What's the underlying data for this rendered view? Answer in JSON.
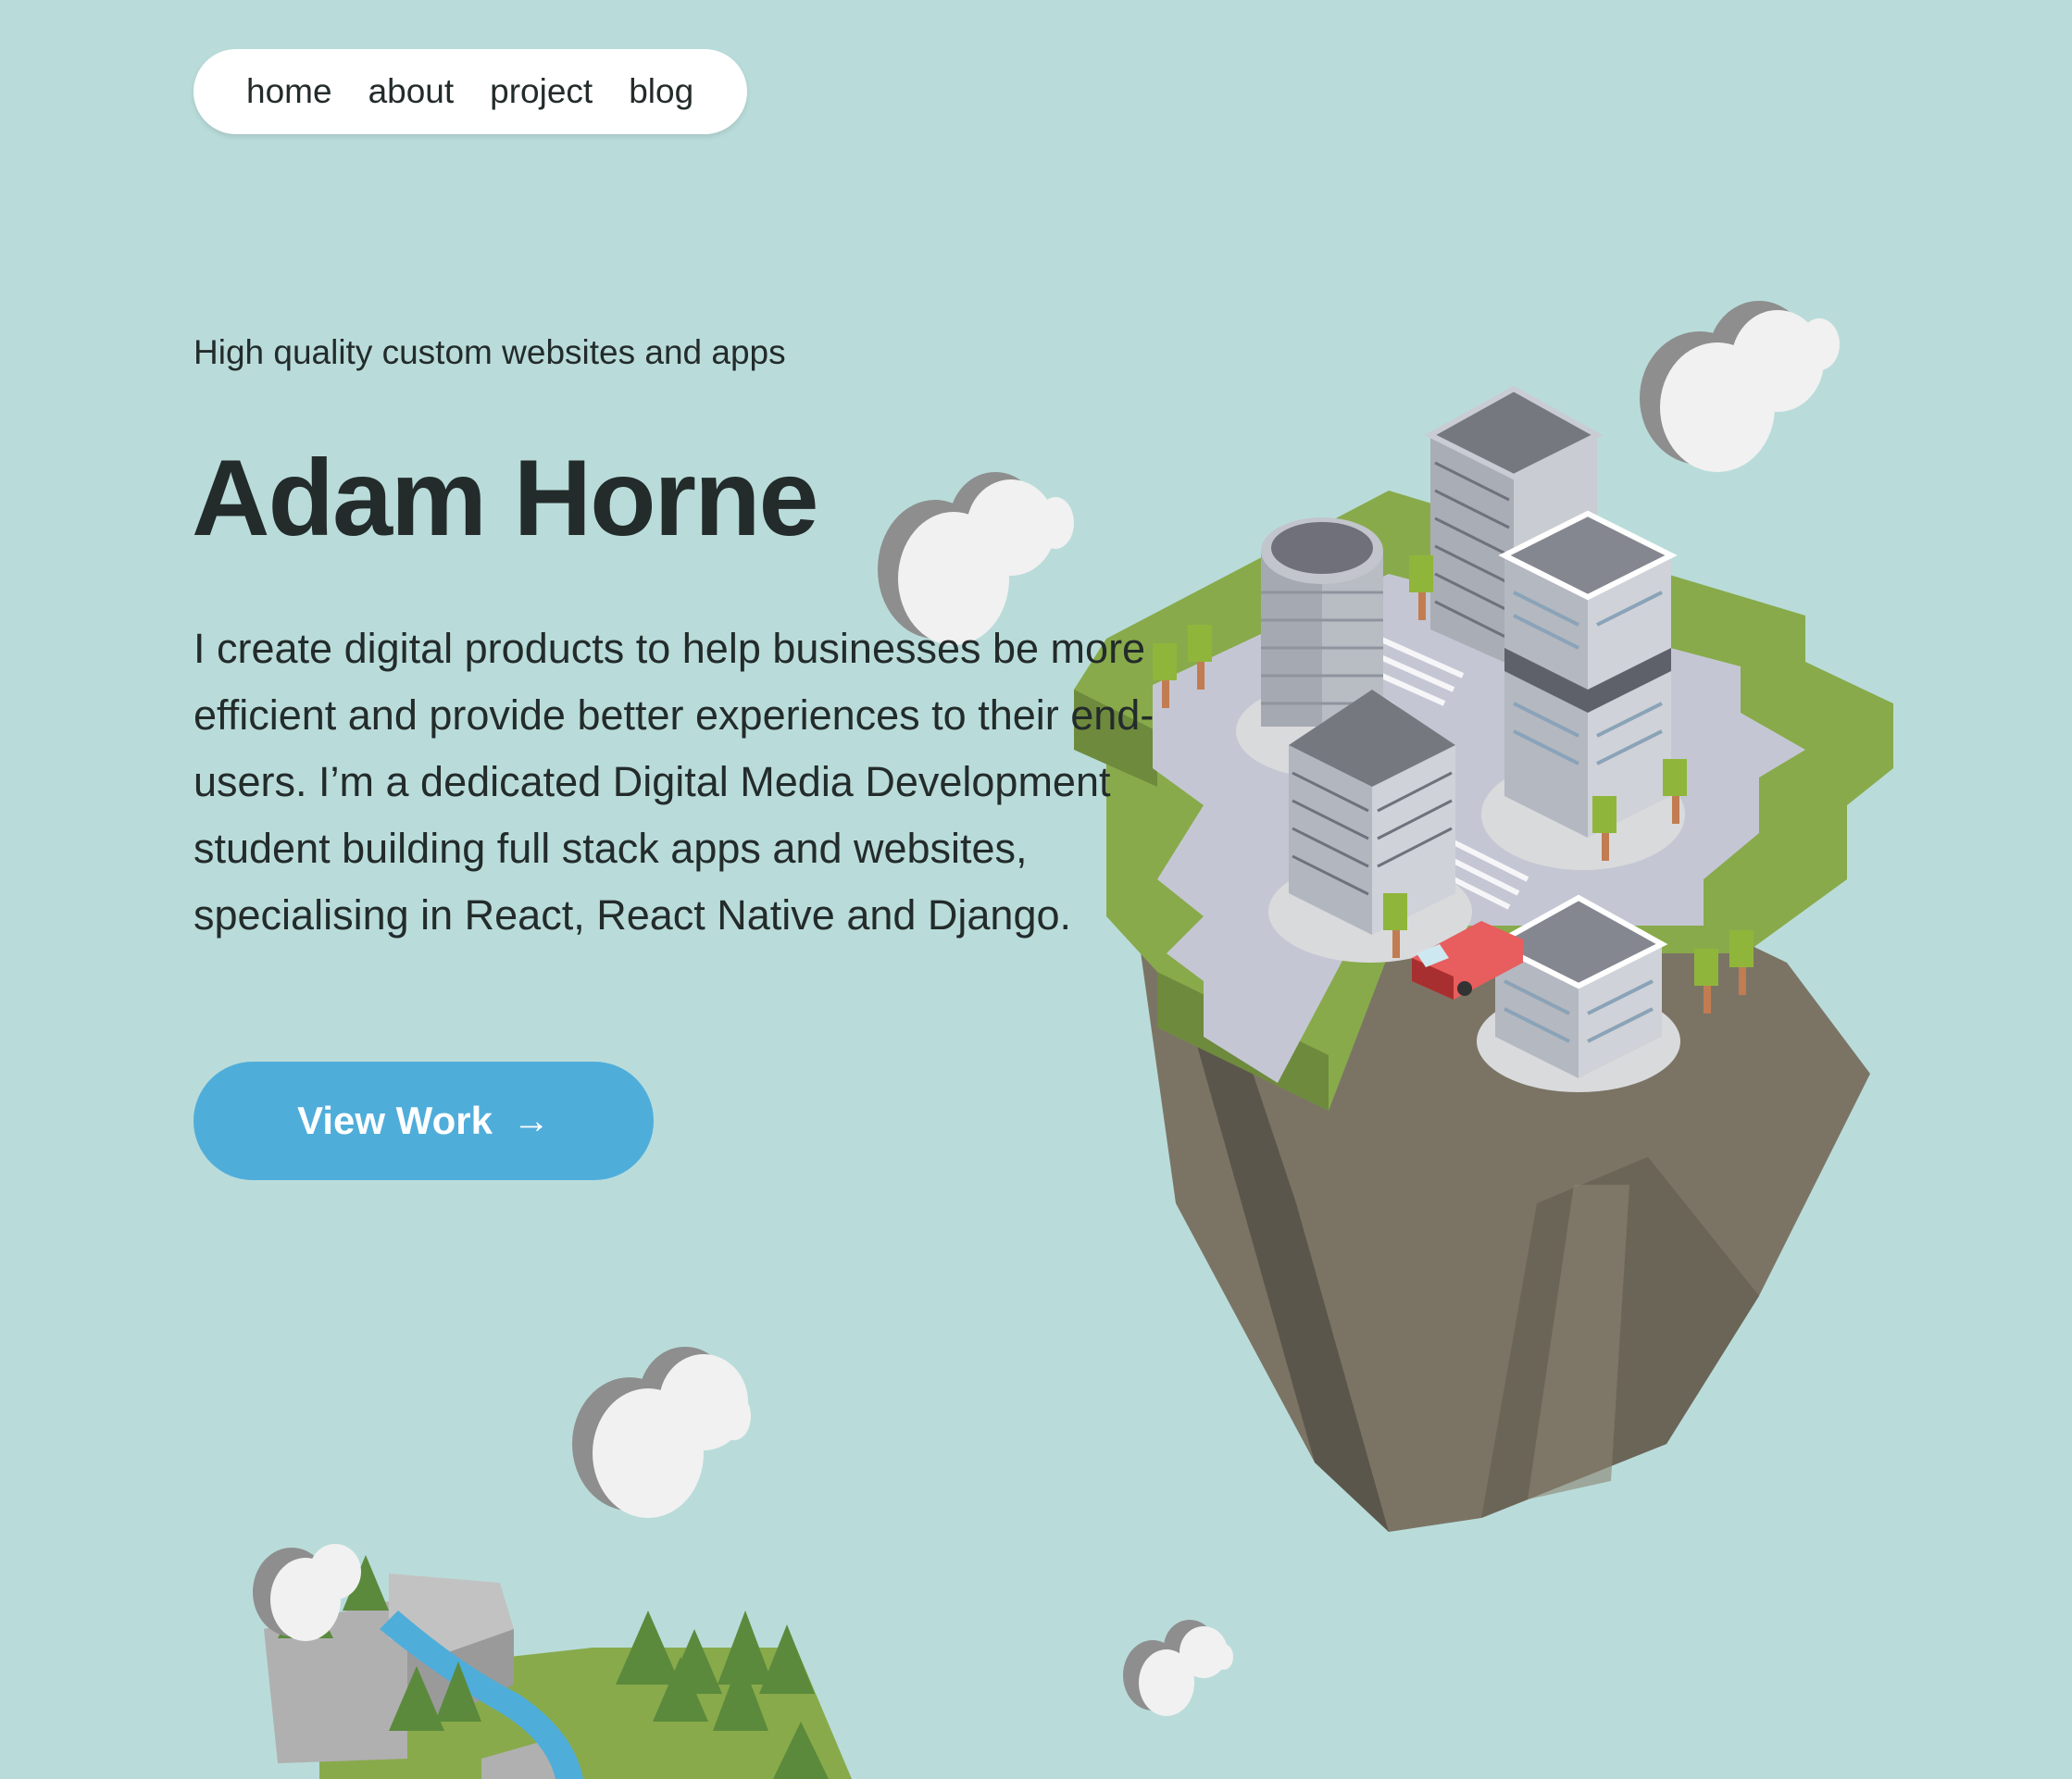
{
  "nav": {
    "items": [
      {
        "label": "home"
      },
      {
        "label": "about"
      },
      {
        "label": "project"
      },
      {
        "label": "blog"
      }
    ]
  },
  "hero": {
    "tagline": "High quality custom websites and apps",
    "name": "Adam Horne",
    "bio": "I create digital products to help businesses be more efficient and provide better experiences to their end-users. I’m a dedicated Digital Media Development student building full stack apps and websites, specialising in React, React Native and Django.",
    "cta_label": "View Work",
    "cta_arrow": "→"
  },
  "colors": {
    "background": "#b9dcda",
    "button": "#4fadda",
    "text": "#232b2b",
    "grass": "#88aa4b",
    "road": "#c4c7d3",
    "rock": "#7b7465",
    "cloud": "#f1f1f1",
    "van": "#e85d5d"
  }
}
